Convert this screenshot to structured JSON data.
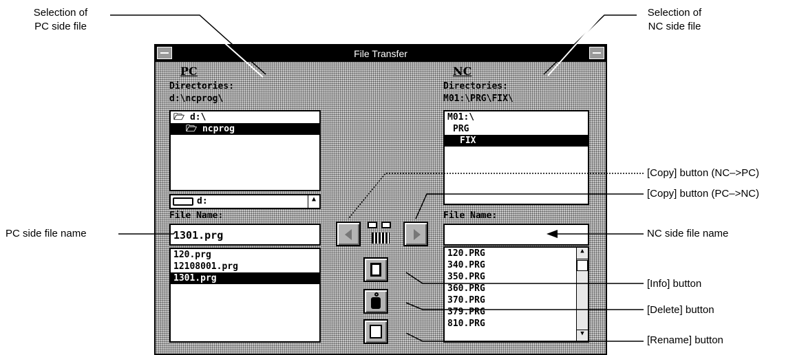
{
  "window": {
    "title": "File Transfer"
  },
  "pc": {
    "header": "PC",
    "dir_label": "Directories:",
    "dir_path": "d:\\ncprog\\",
    "dirs": [
      {
        "name": "d:\\",
        "icon": "open-folder-icon"
      },
      {
        "name": "ncprog",
        "icon": "open-folder-icon"
      }
    ],
    "drive": "d:",
    "file_name_label": "File Name:",
    "file_name_value": "1301.prg",
    "files": [
      "120.prg",
      "12108001.prg",
      "1301.prg"
    ]
  },
  "nc": {
    "header": "NC",
    "dir_label": "Directories:",
    "dir_path": "M01:\\PRG\\FIX\\",
    "dirs": [
      "M01:\\",
      "PRG",
      "FIX"
    ],
    "file_name_label": "File Name:",
    "file_name_value": "",
    "files": [
      "120.PRG",
      "340.PRG",
      "350.PRG",
      "360.PRG",
      "370.PRG",
      "379.PRG",
      "810.PRG"
    ]
  },
  "callouts": {
    "pc_select": "Selection of\nPC side file",
    "nc_select": "Selection of\nNC side file",
    "copy_nc_pc": "[Copy] button (NC–>PC)",
    "copy_pc_nc": "[Copy] button (PC–>NC)",
    "pc_file_name": "PC side file name",
    "nc_file_name": "NC side file name",
    "info": "[Info] button",
    "delete": "[Delete] button",
    "rename": "[Rename] button"
  }
}
